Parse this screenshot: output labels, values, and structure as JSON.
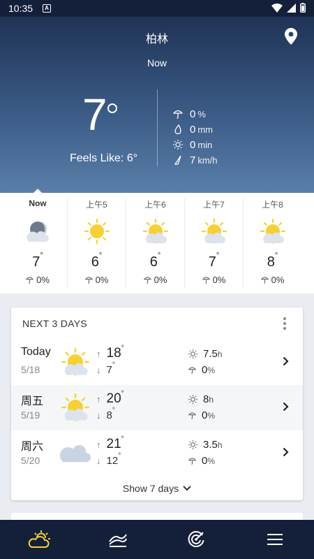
{
  "status_bar": {
    "time": "10:35"
  },
  "header": {
    "city": "柏林",
    "now_label": "Now"
  },
  "current": {
    "temperature": "7",
    "feels_like": "Feels Like: 6°",
    "precip_chance": "0",
    "precip_chance_unit": "%",
    "precip_amount": "0",
    "precip_amount_unit": "mm",
    "sunshine": "0",
    "sunshine_unit": "min",
    "wind": "7",
    "wind_unit": "km/h"
  },
  "hourly": [
    {
      "label": "Now",
      "icon": "moon-cloud-icon",
      "temp": "7",
      "precip": "0%"
    },
    {
      "label": "上午5",
      "icon": "sun-icon",
      "temp": "6",
      "precip": "0%"
    },
    {
      "label": "上午6",
      "icon": "sun-cloud-icon",
      "temp": "6",
      "precip": "0%"
    },
    {
      "label": "上午7",
      "icon": "sun-cloud-icon",
      "temp": "7",
      "precip": "0%"
    },
    {
      "label": "上午8",
      "icon": "sun-cloud-icon",
      "temp": "8",
      "precip": "0%"
    }
  ],
  "next_days": {
    "title": "NEXT 3 DAYS",
    "days": [
      {
        "name": "Today",
        "date": "5/18",
        "icon": "sun-cloud-icon",
        "high": "18",
        "low": "7",
        "sun": "7.5",
        "sun_unit": "h",
        "precip": "0",
        "precip_unit": "%"
      },
      {
        "name": "周五",
        "date": "5/19",
        "icon": "sun-cloud-icon",
        "high": "20",
        "low": "8",
        "sun": "8",
        "sun_unit": "h",
        "precip": "0",
        "precip_unit": "%"
      },
      {
        "name": "周六",
        "date": "5/20",
        "icon": "cloud-icon",
        "high": "21",
        "low": "12",
        "sun": "3.5",
        "sun_unit": "h",
        "precip": "0",
        "precip_unit": "%"
      }
    ],
    "show_more_label": "Show 7 days"
  },
  "nav": {
    "items": [
      "weather-icon",
      "trend-icon",
      "radar-icon",
      "menu-icon"
    ]
  },
  "colors": {
    "header_dark": "#1f3356",
    "nav_bg": "#14203a",
    "accent_yellow": "#f5d33a"
  }
}
